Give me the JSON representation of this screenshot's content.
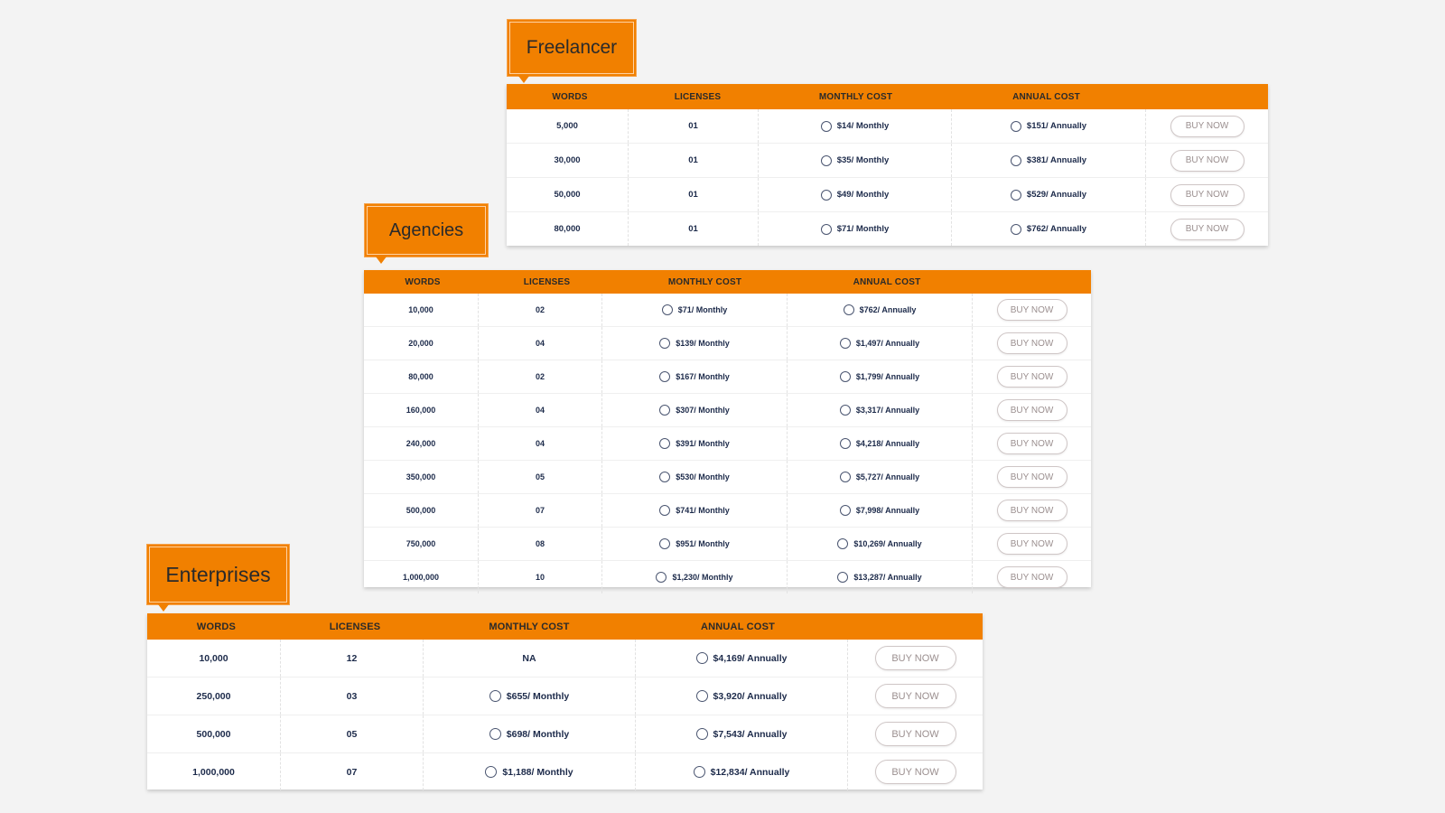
{
  "colors": {
    "accent": "#f18000",
    "text": "#1c2a4a",
    "background": "#f3f3f3",
    "button_text": "#9b8f8f"
  },
  "columns": {
    "words": "WORDS",
    "licenses": "LICENSES",
    "monthly": "MONTHLY COST",
    "annual": "ANNUAL COST"
  },
  "buy_label": "BUY NOW",
  "freelancer": {
    "title": "Freelancer",
    "rows": [
      {
        "words": "5,000",
        "licenses": "01",
        "monthly": "$14/ Monthly",
        "annual": "$151/ Annually"
      },
      {
        "words": "30,000",
        "licenses": "01",
        "monthly": "$35/ Monthly",
        "annual": "$381/ Annually"
      },
      {
        "words": "50,000",
        "licenses": "01",
        "monthly": "$49/ Monthly",
        "annual": "$529/ Annually"
      },
      {
        "words": "80,000",
        "licenses": "01",
        "monthly": "$71/ Monthly",
        "annual": "$762/ Annually"
      }
    ]
  },
  "agencies": {
    "title": "Agencies",
    "rows": [
      {
        "words": "10,000",
        "licenses": "02",
        "monthly": "$71/ Monthly",
        "annual": "$762/ Annually"
      },
      {
        "words": "20,000",
        "licenses": "04",
        "monthly": "$139/ Monthly",
        "annual": "$1,497/ Annually"
      },
      {
        "words": "80,000",
        "licenses": "02",
        "monthly": "$167/ Monthly",
        "annual": "$1,799/ Annually"
      },
      {
        "words": "160,000",
        "licenses": "04",
        "monthly": "$307/ Monthly",
        "annual": "$3,317/ Annually"
      },
      {
        "words": "240,000",
        "licenses": "04",
        "monthly": "$391/ Monthly",
        "annual": "$4,218/ Annually"
      },
      {
        "words": "350,000",
        "licenses": "05",
        "monthly": "$530/ Monthly",
        "annual": "$5,727/ Annually"
      },
      {
        "words": "500,000",
        "licenses": "07",
        "monthly": "$741/ Monthly",
        "annual": "$7,998/ Annually"
      },
      {
        "words": "750,000",
        "licenses": "08",
        "monthly": "$951/ Monthly",
        "annual": "$10,269/ Annually"
      },
      {
        "words": "1,000,000",
        "licenses": "10",
        "monthly": "$1,230/ Monthly",
        "annual": "$13,287/ Annually"
      }
    ]
  },
  "enterprises": {
    "title": "Enterprises",
    "rows": [
      {
        "words": "10,000",
        "licenses": "12",
        "monthly": "NA",
        "annual": "$4,169/ Annually"
      },
      {
        "words": "250,000",
        "licenses": "03",
        "monthly": "$655/ Monthly",
        "annual": "$3,920/ Annually"
      },
      {
        "words": "500,000",
        "licenses": "05",
        "monthly": "$698/ Monthly",
        "annual": "$7,543/ Annually"
      },
      {
        "words": "1,000,000",
        "licenses": "07",
        "monthly": "$1,188/ Monthly",
        "annual": "$12,834/ Annually"
      }
    ]
  }
}
